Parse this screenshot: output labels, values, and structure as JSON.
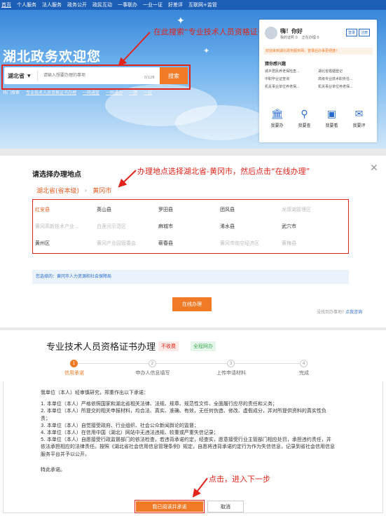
{
  "nav": {
    "items": [
      "首页",
      "个人服务",
      "法人服务",
      "政务公开",
      "政民互动",
      "一事联办",
      "一业一证",
      "好差评",
      "互联网+监管"
    ]
  },
  "panel1": {
    "welcome": "湖北政务欢迎您",
    "region": "湖北省",
    "search_placeholder": "请输入想要办理的事项",
    "search_count": "0/128",
    "search_button": "搜索",
    "hot_items": [
      "热门搜索",
      "专业技术人员资格证书办理",
      "一网通管",
      "一网通办",
      "一键",
      "一证"
    ],
    "annotation": "在此搜索“专业技术人员资格证书办理”",
    "user_card": {
      "greeting": "嗨！你好",
      "my_certs": "我的证照 0",
      "in_progress": "正在办理 0",
      "login": "登录",
      "register": "注册",
      "notice": "欢迎来到湖北政务服务网，登录后办事更便捷！",
      "section_title": "猜你感兴趣",
      "services": [
        "城乡居民养老保险查...",
        "湖北省婚姻登记",
        "中职毕业证查询",
        "高级专业技术职务任...",
        "机关事业单位养老保...",
        "机关事业单位养老保..."
      ],
      "quick": [
        "我要办",
        "我要查",
        "我要看",
        "我要评"
      ]
    }
  },
  "panel2": {
    "title": "请选择办理地点",
    "annotation": "办理地点选择湖北省-黄冈市，然后点击“在线办理”",
    "province": "湖北省(省本级)",
    "city": "黄冈市",
    "cities": [
      "红安县",
      "英山县",
      "罗田县",
      "团风县",
      "龙感湖管理区",
      "黄冈高新技术产业...",
      "白莲河示范区",
      "麻城市",
      "浠水县",
      "武穴市",
      "黄州区",
      "黄冈产业园管委会",
      "蕲春县",
      "黄冈市临空经济区",
      "黄梅县"
    ],
    "selected": "您选择的：黄冈市人力资源和社会保障局",
    "online_button": "在线办理",
    "help_prefix": "没找到办事地?",
    "help_link": "点我咨询"
  },
  "panel3": {
    "title": "专业技术人员资格证书办理",
    "badge_fee": "不收费",
    "badge_net": "全程网办",
    "steps": [
      {
        "num": "1",
        "label": "信用承诺"
      },
      {
        "num": "2",
        "label": "申办人信息填写"
      },
      {
        "num": "3",
        "label": "上传申请材料"
      },
      {
        "num": "4",
        "label": "完成"
      }
    ],
    "promise_lead": "我单位（本人）经审慎研究，郑重作出以下承诺：",
    "promise_items": [
      "1. 本单位（本人）严格依照国家和湖北省相关法律、法规、规章、规范性文件、全面履行应尽的责任和义务；",
      "2. 本单位（本人）所提交的相关申报材料，均合法、真实、准确、有效，无任何伪造、修改、虚假成分，并对所提供资料的真实性负责；",
      "3. 本单位（本人）自觉接受政府、行业组织、社会公众新闻舆论的监督；",
      "4. 本单位（本人）在信用中国（湖北）网站中无违法违规、较重或严重失信记录；",
      "5. 本单位（本人）自愿接受行政监督部门的依法检查，若违背承诺约定，经查实，愿意接受行业主管部门相应处罚，承担违约责任，并依法承担相应的法律责任。按照《湖北省社会信用信息管理条例》规定，自愿将违背承诺约定行为作为失信信息，记录到省社会信用信息服务平台并予以公开。"
    ],
    "promise_end": "特此承诺。",
    "annotation": "点击，进入下一步",
    "agree_button": "我已阅读并承诺",
    "cancel_button": "取消"
  },
  "colors": {
    "accent": "#f07a26",
    "annotation_red": "#e2231a",
    "nav_blue": "#1d5fb7"
  }
}
